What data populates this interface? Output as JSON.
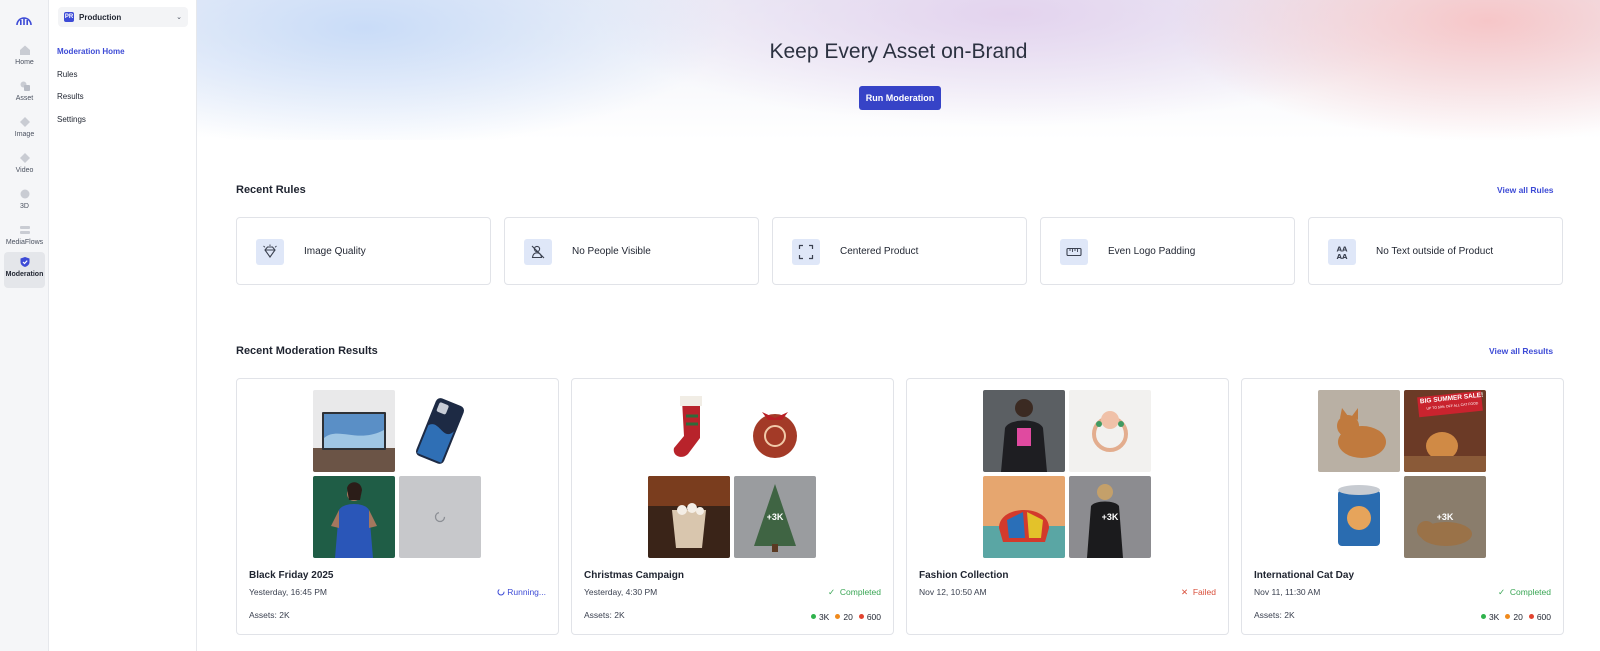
{
  "rail": {
    "items": [
      {
        "label": "Home",
        "icon": "home-icon"
      },
      {
        "label": "Asset",
        "icon": "asset-icon"
      },
      {
        "label": "Image",
        "icon": "image-icon"
      },
      {
        "label": "Video",
        "icon": "video-icon"
      },
      {
        "label": "3D",
        "icon": "cube-icon"
      },
      {
        "label": "MediaFlows",
        "icon": "mediaflows-icon"
      },
      {
        "label": "Moderation",
        "icon": "shield-icon"
      }
    ]
  },
  "env": {
    "badge": "PR",
    "name": "Production"
  },
  "subnav": {
    "items": [
      {
        "label": "Moderation Home"
      },
      {
        "label": "Rules"
      },
      {
        "label": "Results"
      },
      {
        "label": "Settings"
      }
    ]
  },
  "hero": {
    "title": "Keep Every Asset on-Brand",
    "button": "Run Moderation"
  },
  "rules": {
    "title": "Recent Rules",
    "link": "View all Rules",
    "items": [
      {
        "label": "Image Quality",
        "icon": "diamond-icon"
      },
      {
        "label": "No People Visible",
        "icon": "no-person-icon"
      },
      {
        "label": "Centered Product",
        "icon": "frame-corners-icon"
      },
      {
        "label": "Even Logo Padding",
        "icon": "ruler-icon"
      },
      {
        "label": "No Text outside of Product",
        "icon": "text-icon",
        "glyph": "AA\nAA"
      }
    ]
  },
  "results": {
    "title": "Recent Moderation Results",
    "link": "View all Results",
    "items": [
      {
        "title": "Black Friday 2025",
        "time": "Yesterday, 16:45 PM",
        "status": "Running...",
        "assets": "Assets: 2K",
        "more": ""
      },
      {
        "title": "Christmas Campaign",
        "time": "Yesterday, 4:30 PM",
        "status": "Completed",
        "assets": "Assets: 2K",
        "more": "+3K",
        "counts": [
          "3K",
          "20",
          "600"
        ]
      },
      {
        "title": "Fashion Collection",
        "time": "Nov 12, 10:50 AM",
        "status": "Failed",
        "assets": "",
        "more": "+3K"
      },
      {
        "title": "International Cat Day",
        "time": "Nov 11, 11:30 AM",
        "status": "Completed",
        "assets": "Assets: 2K",
        "more": "+3K",
        "counts": [
          "3K",
          "20",
          "600"
        ],
        "more2": "+3K",
        "banner": "BIG SUMMER SALE!",
        "banner_sub": "UP TO 50% OFF ALL CAT FOOD"
      }
    ]
  },
  "colors": {
    "accent": "#3643c7",
    "success": "#3aa655",
    "failed": "#d9503c",
    "dot_green": "#2fb24c",
    "dot_orange": "#f08a1c",
    "dot_red": "#e2432f"
  }
}
